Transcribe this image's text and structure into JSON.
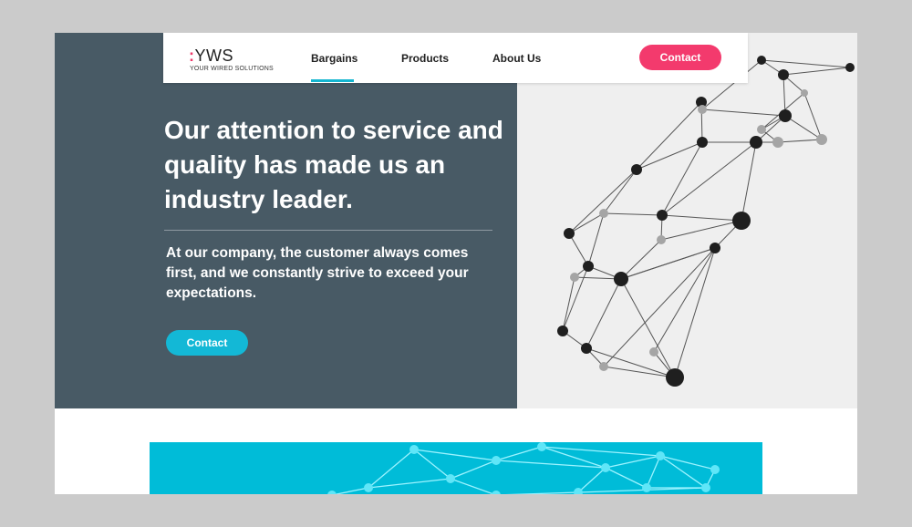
{
  "logo": {
    "colon": ":",
    "mark": "YWS",
    "tagline": "YOUR WIRED SOLUTIONS"
  },
  "nav": {
    "items": [
      {
        "label": "Bargains",
        "active": true
      },
      {
        "label": "Products",
        "active": false
      },
      {
        "label": "About Us",
        "active": false
      }
    ],
    "contact_label": "Contact"
  },
  "hero": {
    "headline": "Our attention to service and quality has made us an industry leader.",
    "subtext": "At our company, the customer always comes first, and we constantly strive to exceed your expectations.",
    "contact_label": "Contact"
  },
  "colors": {
    "hero_bg": "#485a65",
    "accent_pink": "#f33a6d",
    "accent_cyan": "#13b8d6",
    "banner_bg": "#00bcd8"
  }
}
